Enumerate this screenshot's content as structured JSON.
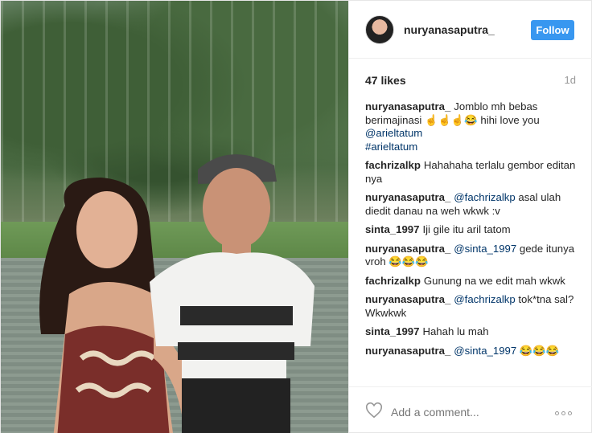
{
  "post": {
    "username": "nuryanasaputra_",
    "follow_label": "Follow",
    "likes": "47 likes",
    "time": "1d",
    "comments": [
      {
        "user": "nuryanasaputra_",
        "text": "Jomblo mh bebas berimajinasi ☝☝☝😂 hihi love you ",
        "mentions": [
          "@arieltatum",
          "#arieltatum"
        ]
      },
      {
        "user": "fachrizalkp",
        "text": "Hahahaha terlalu gembor editan nya"
      },
      {
        "user": "nuryanasaputra_",
        "mention": "@fachrizalkp",
        "text": " asal ulah diedit danau na weh wkwk :v"
      },
      {
        "user": "sinta_1997",
        "text": "Iji gile itu aril tatom"
      },
      {
        "user": "nuryanasaputra_",
        "mention": "@sinta_1997",
        "text": " gede itunya vroh 😂😂😂"
      },
      {
        "user": "fachrizalkp",
        "text": "Gunung na we edit mah wkwk"
      },
      {
        "user": "nuryanasaputra_",
        "mention": "@fachrizalkp",
        "text": " tok*tna sal? Wkwkwk"
      },
      {
        "user": "sinta_1997",
        "text": "Hahah lu mah"
      },
      {
        "user": "nuryanasaputra_",
        "mention": "@sinta_1997",
        "text": " 😂😂😂"
      }
    ],
    "comment_placeholder": "Add a comment...",
    "icons": {
      "heart": "heart-icon",
      "more": "more-options-icon"
    },
    "colors": {
      "follow_bg": "#3897f0",
      "mention": "#003569"
    }
  }
}
